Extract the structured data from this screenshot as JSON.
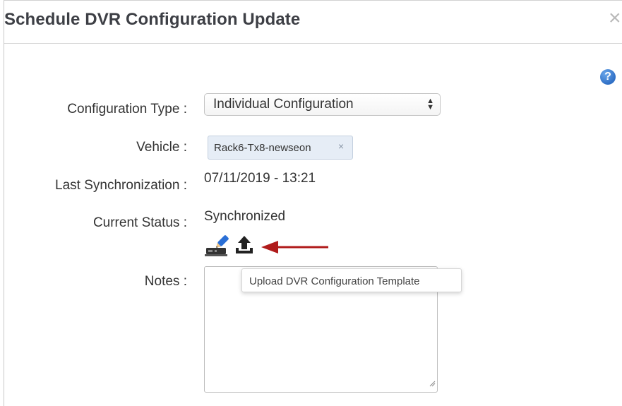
{
  "dialog": {
    "title": "Schedule DVR Configuration Update",
    "close_symbol": "×",
    "help_symbol": "?"
  },
  "form": {
    "config_type_label": "Configuration Type :",
    "config_type_value": "Individual Configuration",
    "vehicle_label": "Vehicle :",
    "vehicle_tag": "Rack6-Tx8-newseon",
    "vehicle_tag_remove": "×",
    "last_sync_label": "Last Synchronization :",
    "last_sync_value": "07/11/2019 - 13:21",
    "status_label": "Current Status :",
    "status_value": "Synchronized",
    "notes_label": "Notes :",
    "notes_value": ""
  },
  "actions": {
    "edit_icon": "edit-config-icon",
    "upload_icon": "upload-icon"
  },
  "tooltip": {
    "text": "Upload DVR Configuration Template"
  },
  "annotation": {
    "arrow_color": "#b01b1b"
  },
  "colors": {
    "help_blue": "#2f6fc5",
    "tag_bg": "#e6edf6"
  }
}
